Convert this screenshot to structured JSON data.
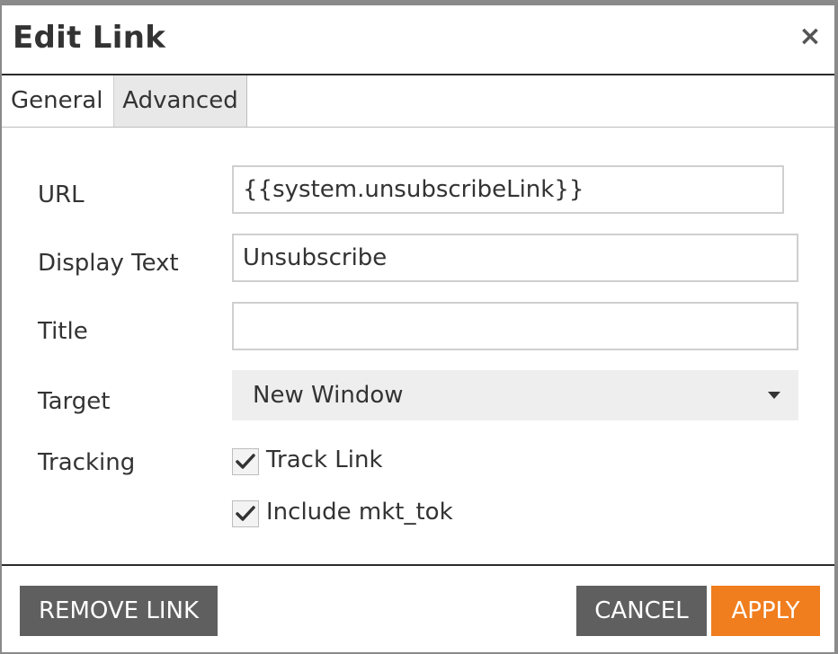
{
  "dialog": {
    "title": "Edit Link",
    "close_glyph": "×",
    "close_icon": "close-icon"
  },
  "tabs": [
    {
      "label": "General",
      "active": true
    },
    {
      "label": "Advanced",
      "active": false
    }
  ],
  "form": {
    "url": {
      "label": "URL",
      "value": "{{system.unsubscribeLink}}"
    },
    "display_text": {
      "label": "Display Text",
      "value": "Unsubscribe"
    },
    "title": {
      "label": "Title",
      "value": ""
    },
    "target": {
      "label": "Target",
      "selected": "New Window",
      "icon": "chevron-down-icon"
    },
    "tracking": {
      "label": "Tracking",
      "options": [
        {
          "label": "Track Link",
          "checked": true
        },
        {
          "label": "Include mkt_tok",
          "checked": true
        }
      ]
    }
  },
  "footer": {
    "remove_label": "REMOVE LINK",
    "cancel_label": "CANCEL",
    "apply_label": "APPLY"
  },
  "colors": {
    "apply": "#f07d1e",
    "secondary_button": "#5f5f5f",
    "select_bg": "#eeeeee"
  }
}
